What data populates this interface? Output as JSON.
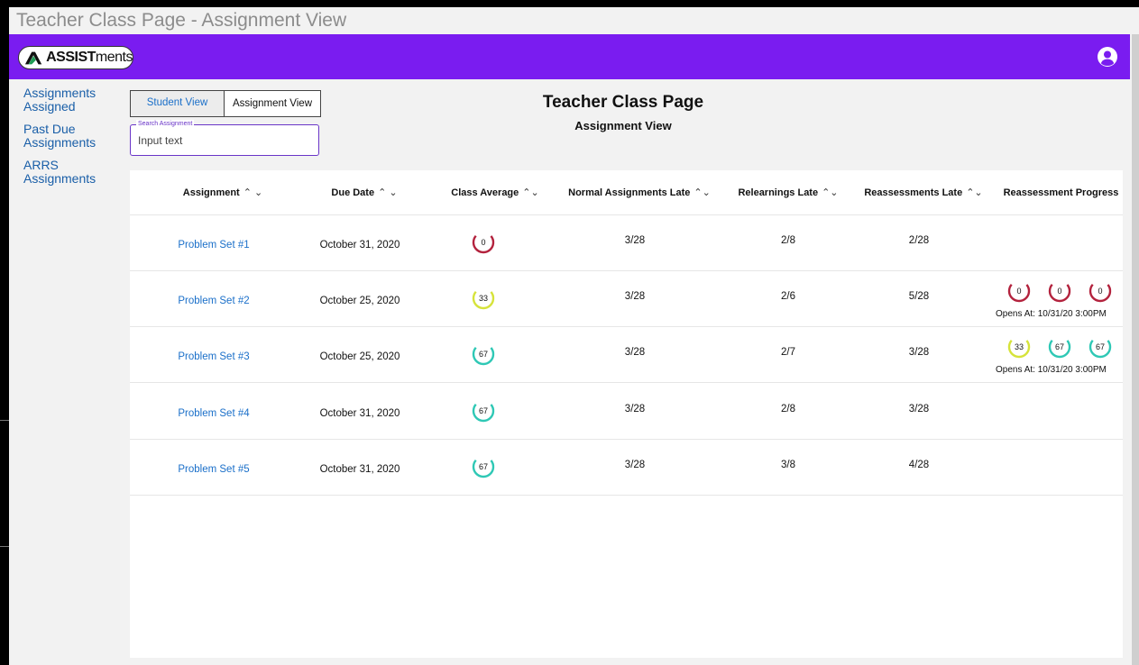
{
  "window": {
    "title": "Teacher Class Page - Assignment View"
  },
  "brand": {
    "logo_bold": "ASSIST",
    "logo_rest": "ments",
    "accent": "#7a1cf0",
    "avatar_icon": "user-circle-icon"
  },
  "sidebar": {
    "items": [
      {
        "label": "Assignments Assigned"
      },
      {
        "label": "Past Due Assignments"
      },
      {
        "label": "ARRS Assignments"
      }
    ]
  },
  "tabs": [
    {
      "label": "Student View"
    },
    {
      "label": "Assignment View"
    }
  ],
  "search": {
    "label": "Search Assignment",
    "value": "Input text"
  },
  "header": {
    "title": "Teacher Class Page",
    "subtitle": "Assignment View"
  },
  "table": {
    "columns": [
      {
        "label": "Assignment",
        "sort": "^ v"
      },
      {
        "label": "Due Date",
        "sort": "^ v"
      },
      {
        "label": "Class Average",
        "sort": "^ v"
      },
      {
        "label": "Normal Assignments Late",
        "sort": "^ v"
      },
      {
        "label": "Relearnings Late",
        "sort": "^ v"
      },
      {
        "label": "Reassessments Late",
        "sort": "^ v"
      },
      {
        "label": "Reassessment Progress",
        "sort": ""
      }
    ],
    "rows": [
      {
        "assignment": "Problem Set #1",
        "due": "October 31, 2020",
        "avg": "0",
        "normal_late": "3/28",
        "relearn_late": "2/8",
        "reassess_late": "2/28",
        "progress": [],
        "opens": ""
      },
      {
        "assignment": "Problem Set #2",
        "due": "October 25, 2020",
        "avg": "33",
        "normal_late": "3/28",
        "relearn_late": "2/6",
        "reassess_late": "5/28",
        "progress": [
          "0",
          "0",
          "0"
        ],
        "opens": "Opens At: 10/31/20 3:00PM"
      },
      {
        "assignment": "Problem Set #3",
        "due": "October 25, 2020",
        "avg": "67",
        "normal_late": "3/28",
        "relearn_late": "2/7",
        "reassess_late": "3/28",
        "progress": [
          "33",
          "67",
          "67"
        ],
        "opens": "Opens At: 10/31/20 3:00PM"
      },
      {
        "assignment": "Problem Set #4",
        "due": "October 31, 2020",
        "avg": "67",
        "normal_late": "3/28",
        "relearn_late": "2/8",
        "reassess_late": "3/28",
        "progress": [],
        "opens": ""
      },
      {
        "assignment": "Problem Set #5",
        "due": "October 31, 2020",
        "avg": "67",
        "normal_late": "3/28",
        "relearn_late": "3/8",
        "reassess_late": "4/28",
        "progress": [],
        "opens": ""
      }
    ]
  },
  "ring_colors": {
    "0": "#b3223d",
    "33": "#d6e33a",
    "67": "#2ec8b5"
  }
}
